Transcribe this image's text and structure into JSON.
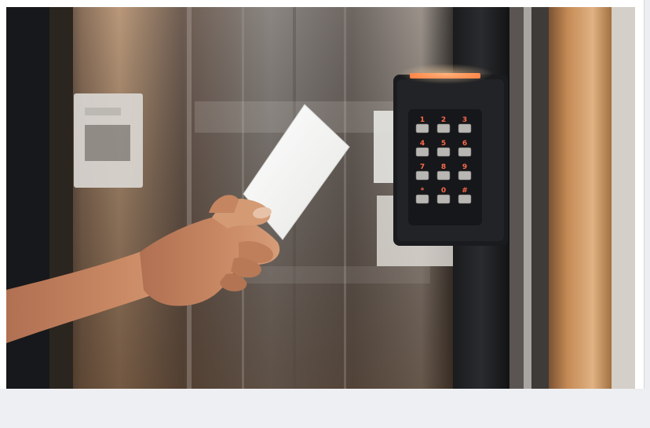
{
  "image": {
    "subject": "hand-holding-access-card-at-keypad-reader"
  },
  "keypad": {
    "keys": [
      "1",
      "2",
      "3",
      "4",
      "5",
      "6",
      "7",
      "8",
      "9",
      "*",
      "0",
      "#"
    ],
    "label_color": "#ff6a4a",
    "indicator_color": "#ff7a3a"
  },
  "colors": {
    "background_dark": "#1c1d20",
    "wood": "#c98a4e",
    "steel": "#6f6a66",
    "reader_body": "#1a1b1e",
    "card": "#f7f7f5",
    "skin": "#c98964"
  }
}
